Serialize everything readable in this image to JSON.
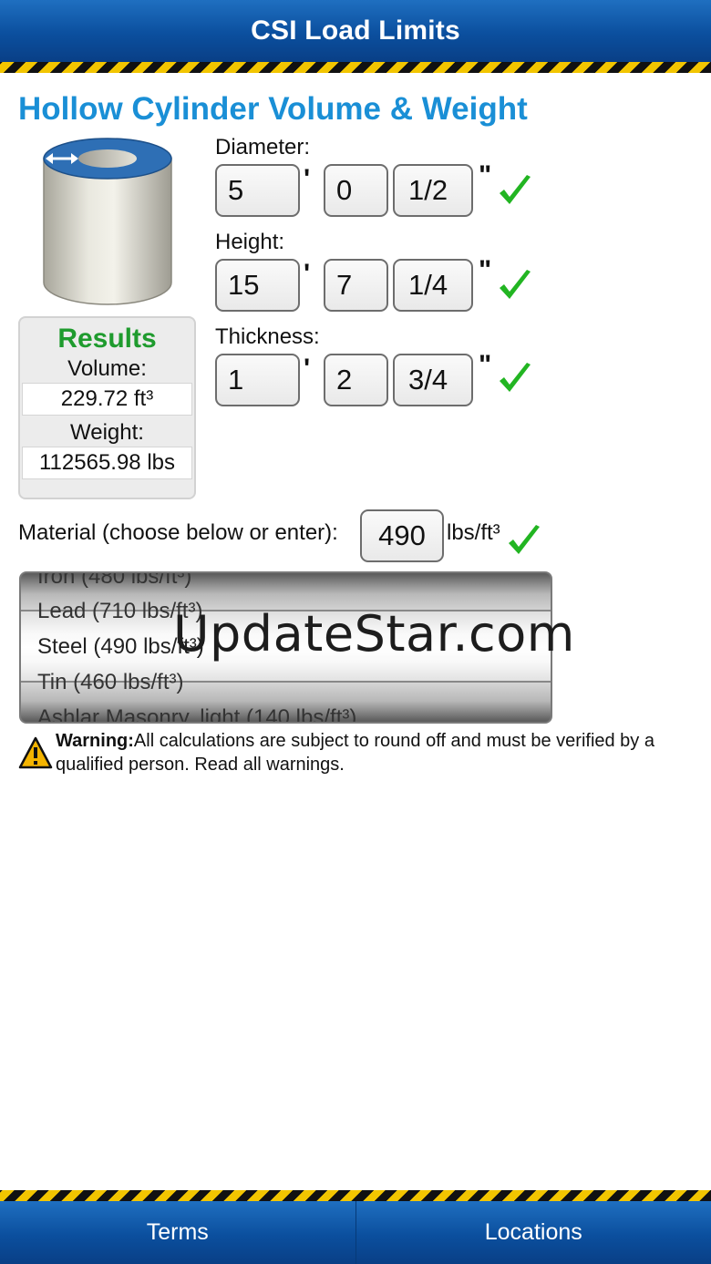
{
  "header": {
    "title": "CSI Load Limits"
  },
  "calculator": {
    "title": "Hollow Cylinder Volume & Weight"
  },
  "results": {
    "title": "Results",
    "volume_label": "Volume:",
    "volume_value": "229.72 ft³",
    "weight_label": "Weight:",
    "weight_value": "112565.98 lbs"
  },
  "diameter": {
    "label": "Diameter:",
    "feet": "5",
    "inches": "0",
    "fraction": "1/2"
  },
  "height": {
    "label": "Height:",
    "feet": "15",
    "inches": "7",
    "fraction": "1/4"
  },
  "thickness": {
    "label": "Thickness:",
    "feet": "1",
    "inches": "2",
    "fraction": "3/4"
  },
  "units": {
    "feet_mark": "'",
    "inch_mark": "\""
  },
  "material": {
    "label": "Material (choose below or enter):",
    "density_value": "490",
    "density_unit": "lbs/ft³",
    "options": [
      "Iron (480 lbs/ft³)",
      "Lead (710 lbs/ft³)",
      "Steel (490 lbs/ft³)",
      "Tin (460 lbs/ft³)",
      "Ashlar Masonry, light (140 lbs/ft³)"
    ],
    "selected": "Steel (490 lbs/ft³)"
  },
  "watermark": "UpdateStar.com",
  "warning": {
    "bold": "Warning:",
    "text": "All calculations are subject to round off and must be verified by a qualified person. Read all warnings."
  },
  "footer": {
    "terms": "Terms",
    "locations": "Locations"
  },
  "colors": {
    "header_blue": "#0b4f9e",
    "title_blue": "#1a8fd6",
    "results_green": "#1f9b2e",
    "check_green": "#22b522",
    "stripe_yellow": "#f2c500"
  }
}
